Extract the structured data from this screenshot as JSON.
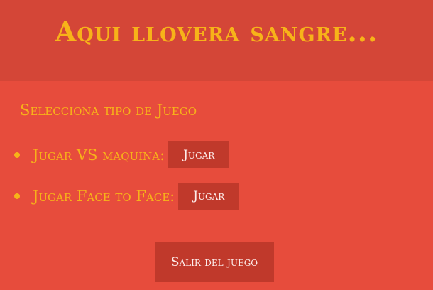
{
  "header": {
    "title": "Aqui llovera sangre..."
  },
  "main": {
    "section_label": "Selecciona tipo de Juego",
    "modes": [
      {
        "label": "Jugar VS maquina:",
        "button_label": "Jugar"
      },
      {
        "label": "Jugar Face to Face:",
        "button_label": "Jugar"
      }
    ],
    "exit_label": "Salir del juego"
  },
  "colors": {
    "background": "#e74c3c",
    "header_background": "#d44637",
    "accent_text": "#f7b319",
    "button_background": "#c0392b",
    "button_text": "#fdecea"
  }
}
